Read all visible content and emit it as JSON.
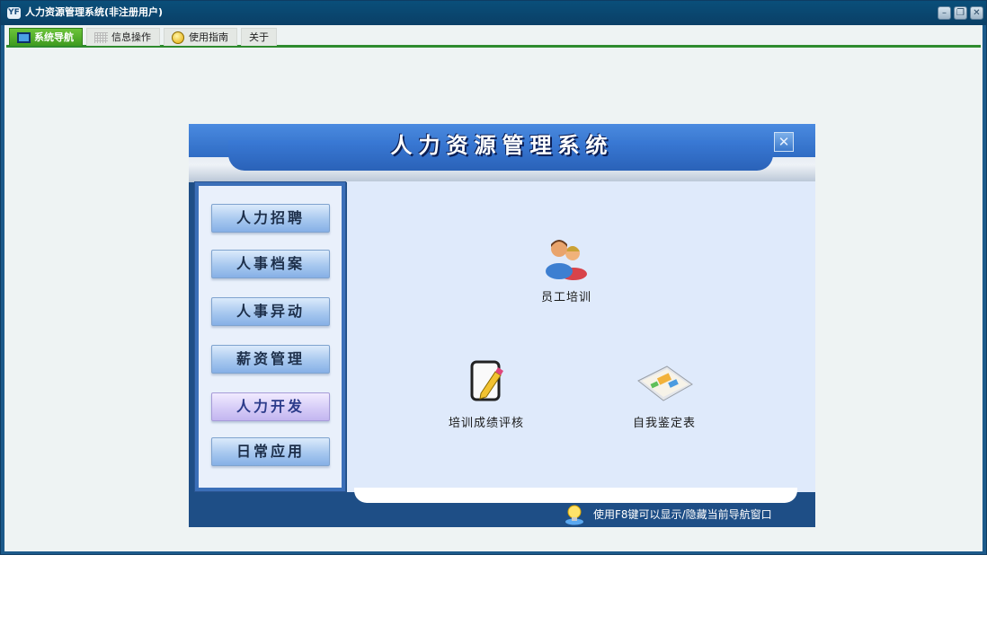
{
  "window": {
    "title": "人力资源管理系统(非注册用户)",
    "icon_text": "YF",
    "controls": {
      "minimize": "–",
      "restore": "❐",
      "close": "✕"
    }
  },
  "tabs": [
    {
      "label": "系统导航",
      "active": true
    },
    {
      "label": "信息操作",
      "active": false
    },
    {
      "label": "使用指南",
      "active": false
    },
    {
      "label": "关于",
      "active": false
    }
  ],
  "panel": {
    "title": "人力资源管理系统",
    "close_glyph": "✕",
    "nav": [
      {
        "label": "人力招聘",
        "active": false
      },
      {
        "label": "人事档案",
        "active": false
      },
      {
        "label": "人事异动",
        "active": false
      },
      {
        "label": "薪资管理",
        "active": false
      },
      {
        "label": "人力开发",
        "active": true
      },
      {
        "label": "日常应用",
        "active": false
      }
    ],
    "items": [
      {
        "label": "员工培训",
        "icon": "people-icon"
      },
      {
        "label": "培训成绩评核",
        "icon": "edit-document-icon"
      },
      {
        "label": "自我鉴定表",
        "icon": "form-paper-icon"
      }
    ],
    "footer_tip": "使用F8键可以显示/隐藏当前导航窗口"
  },
  "colors": {
    "titlebar": "#0a4f7a",
    "active_tab": "#4fae28",
    "panel_header": "#2f6cc4",
    "panel_footer": "#1e4e86",
    "active_nav": "#d6ccf7"
  }
}
